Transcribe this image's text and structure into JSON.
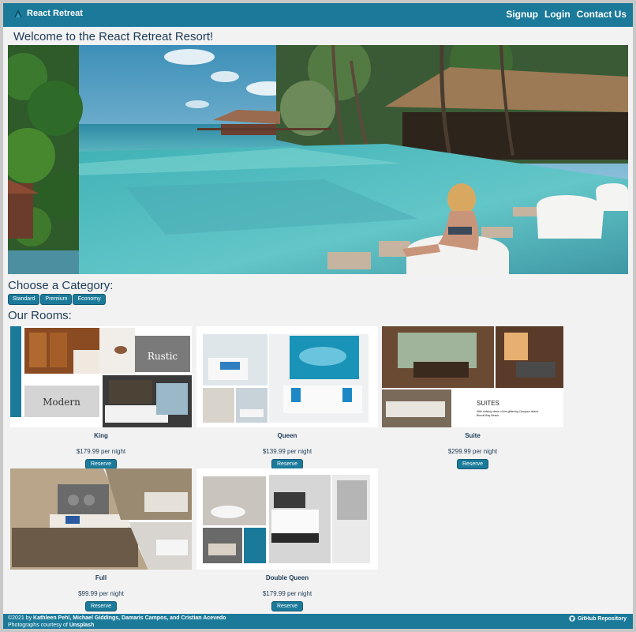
{
  "nav": {
    "brand": "React Retreat",
    "links": [
      "Signup",
      "Login",
      "Contact Us"
    ]
  },
  "welcome": "Welcome to the React Retreat Resort!",
  "categories": {
    "title": "Choose a Category:",
    "buttons": [
      "Standard",
      "Premium",
      "Economy"
    ]
  },
  "rooms": {
    "title": "Our Rooms:",
    "reserve_label": "Reserve",
    "items": [
      {
        "name": "King",
        "price": "$179.99 per night",
        "collage_text": [
          "Rustic",
          "Modern"
        ]
      },
      {
        "name": "Queen",
        "price": "$139.99 per night"
      },
      {
        "name": "Suite",
        "price": "$299.99 per night",
        "collage_text": [
          "SUITES",
          "With striking views of the glittering Cauayan Island",
          "Biscuit Bay Beach"
        ]
      },
      {
        "name": "Full",
        "price": "$99.99 per night"
      },
      {
        "name": "Double Queen",
        "price": "$179.99 per night"
      }
    ]
  },
  "footer": {
    "copyright_prefix": "©2021 by",
    "authors": "Kathleen Pehl, Michael Giddings, Damaris Campos, and Cristian Acevedo",
    "photos_prefix": "Photographs courtesy of",
    "photos_source": "Unsplash",
    "repo_link": "GitHub Repository"
  },
  "colors": {
    "brand": "#1b7a9a",
    "page_bg": "#f2f2f2",
    "heading": "#1d3b57"
  }
}
